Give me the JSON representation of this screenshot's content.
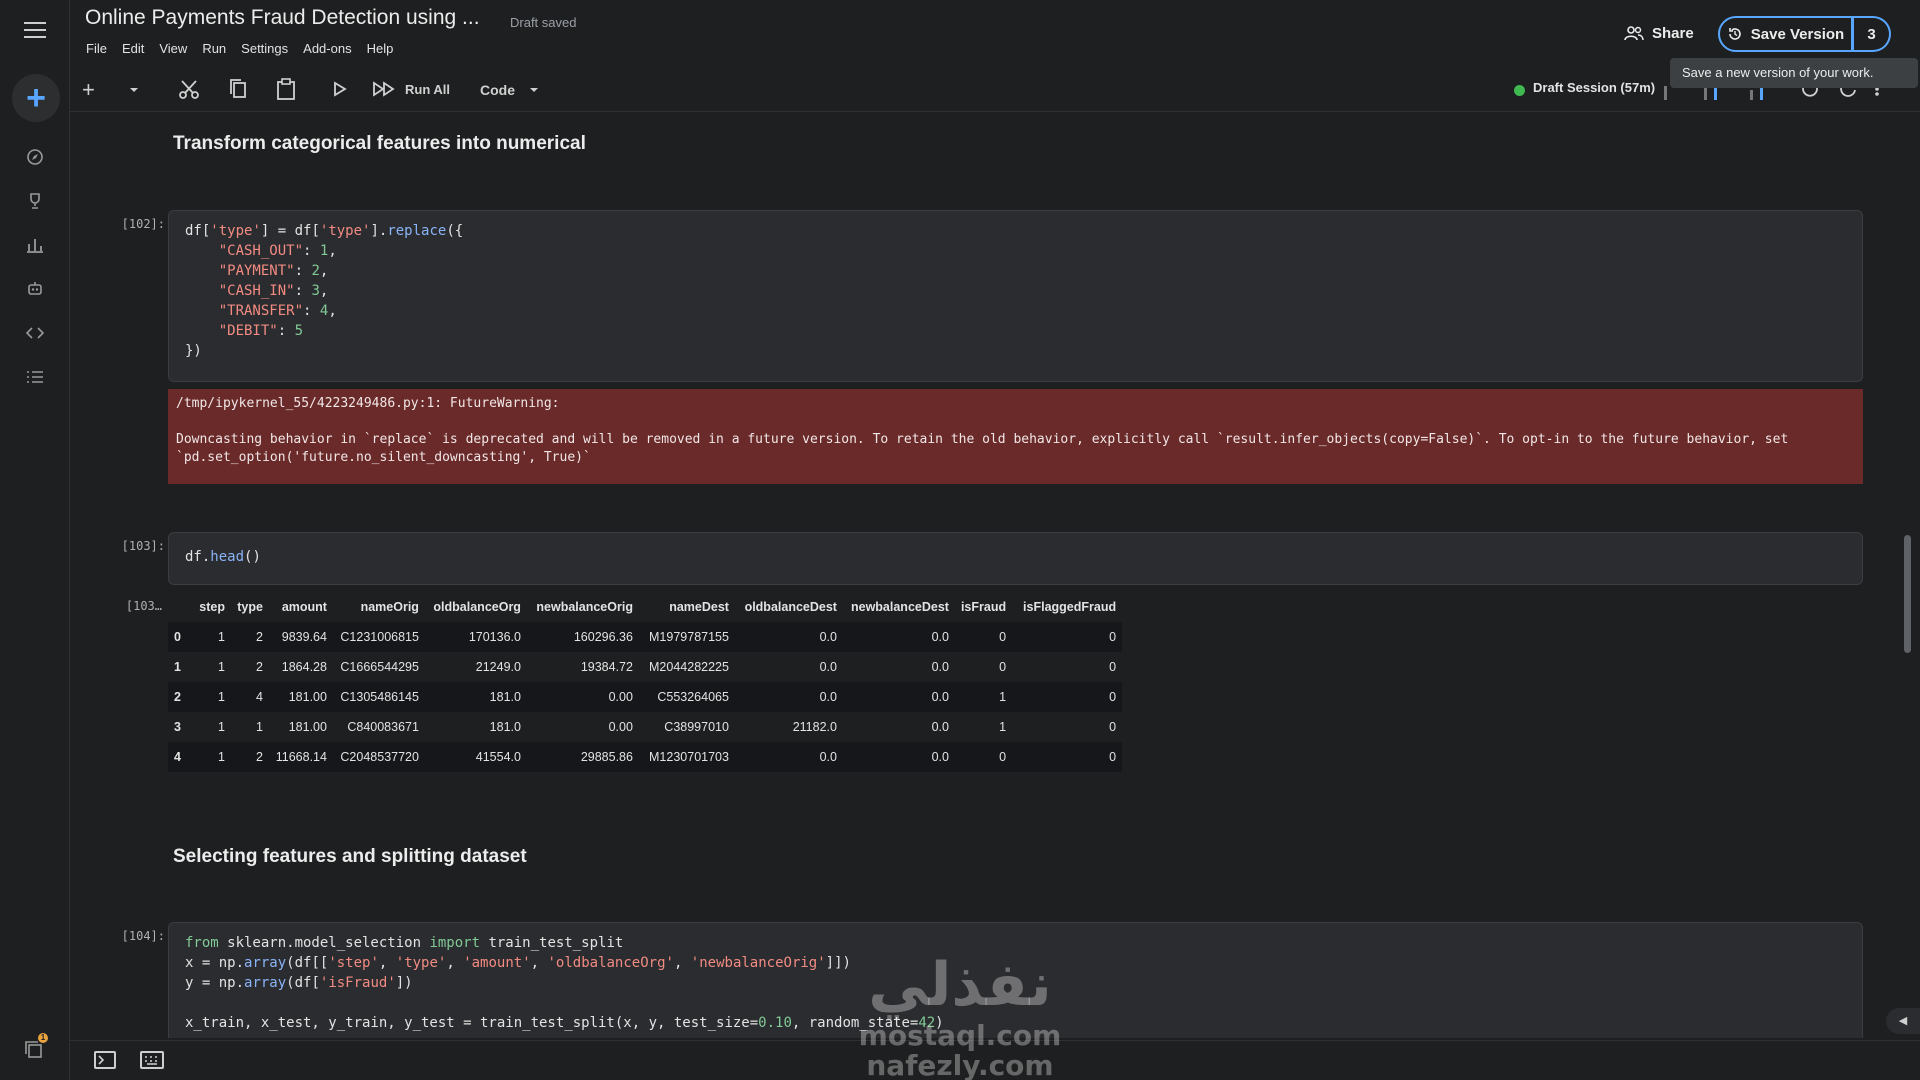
{
  "header": {
    "title": "Online Payments Fraud Detection using ...",
    "status": "Draft saved",
    "menu": [
      "File",
      "Edit",
      "View",
      "Run",
      "Settings",
      "Add-ons",
      "Help"
    ],
    "share_label": "Share",
    "save_version_label": "Save Version",
    "version_count": "3",
    "tooltip": "Save a new version of your work."
  },
  "toolbar": {
    "run_all_label": "Run All",
    "cell_type": "Code",
    "session": "Draft Session (57m)"
  },
  "cells": {
    "h1": "Transform categorical features into numerical",
    "c102": {
      "prompt": "[102]:",
      "warning_path": "/tmp/ipykernel_55/4223249486.py:1: FutureWarning:",
      "warning_text": "Downcasting behavior in `replace` is deprecated and will be removed in a future version. To retain the old behavior, explicitly call `result.infer_objects(copy=False)`. To opt-in to the future behavior, set `pd.set_option('future.no_silent_downcasting', True)`"
    },
    "c103": {
      "prompt": "[103]:",
      "out_prompt": "[103…"
    },
    "h2": "Selecting features and splitting dataset",
    "c104": {
      "prompt": "[104]:"
    }
  },
  "dataframe": {
    "columns": [
      "",
      "step",
      "type",
      "amount",
      "nameOrig",
      "oldbalanceOrg",
      "newbalanceOrig",
      "nameDest",
      "oldbalanceDest",
      "newbalanceDest",
      "isFraud",
      "isFlaggedFraud"
    ],
    "rows": [
      [
        "0",
        "1",
        "2",
        "9839.64",
        "C1231006815",
        "170136.0",
        "160296.36",
        "M1979787155",
        "0.0",
        "0.0",
        "0",
        "0"
      ],
      [
        "1",
        "1",
        "2",
        "1864.28",
        "C1666544295",
        "21249.0",
        "19384.72",
        "M2044282225",
        "0.0",
        "0.0",
        "0",
        "0"
      ],
      [
        "2",
        "1",
        "4",
        "181.00",
        "C1305486145",
        "181.0",
        "0.00",
        "C553264065",
        "0.0",
        "0.0",
        "1",
        "0"
      ],
      [
        "3",
        "1",
        "1",
        "181.00",
        "C840083671",
        "181.0",
        "0.00",
        "C38997010",
        "21182.0",
        "0.0",
        "1",
        "0"
      ],
      [
        "4",
        "1",
        "2",
        "11668.14",
        "C2048537720",
        "41554.0",
        "29885.86",
        "M1230701703",
        "0.0",
        "0.0",
        "0",
        "0"
      ]
    ]
  },
  "colors": {
    "accent": "#58a6ff",
    "session_dot": "#3fb950",
    "warning_bg": "#6a2a2a"
  },
  "watermark": {
    "script": "نفذلي",
    "line1": "mostaql.com",
    "line2": "nafezly.com"
  }
}
